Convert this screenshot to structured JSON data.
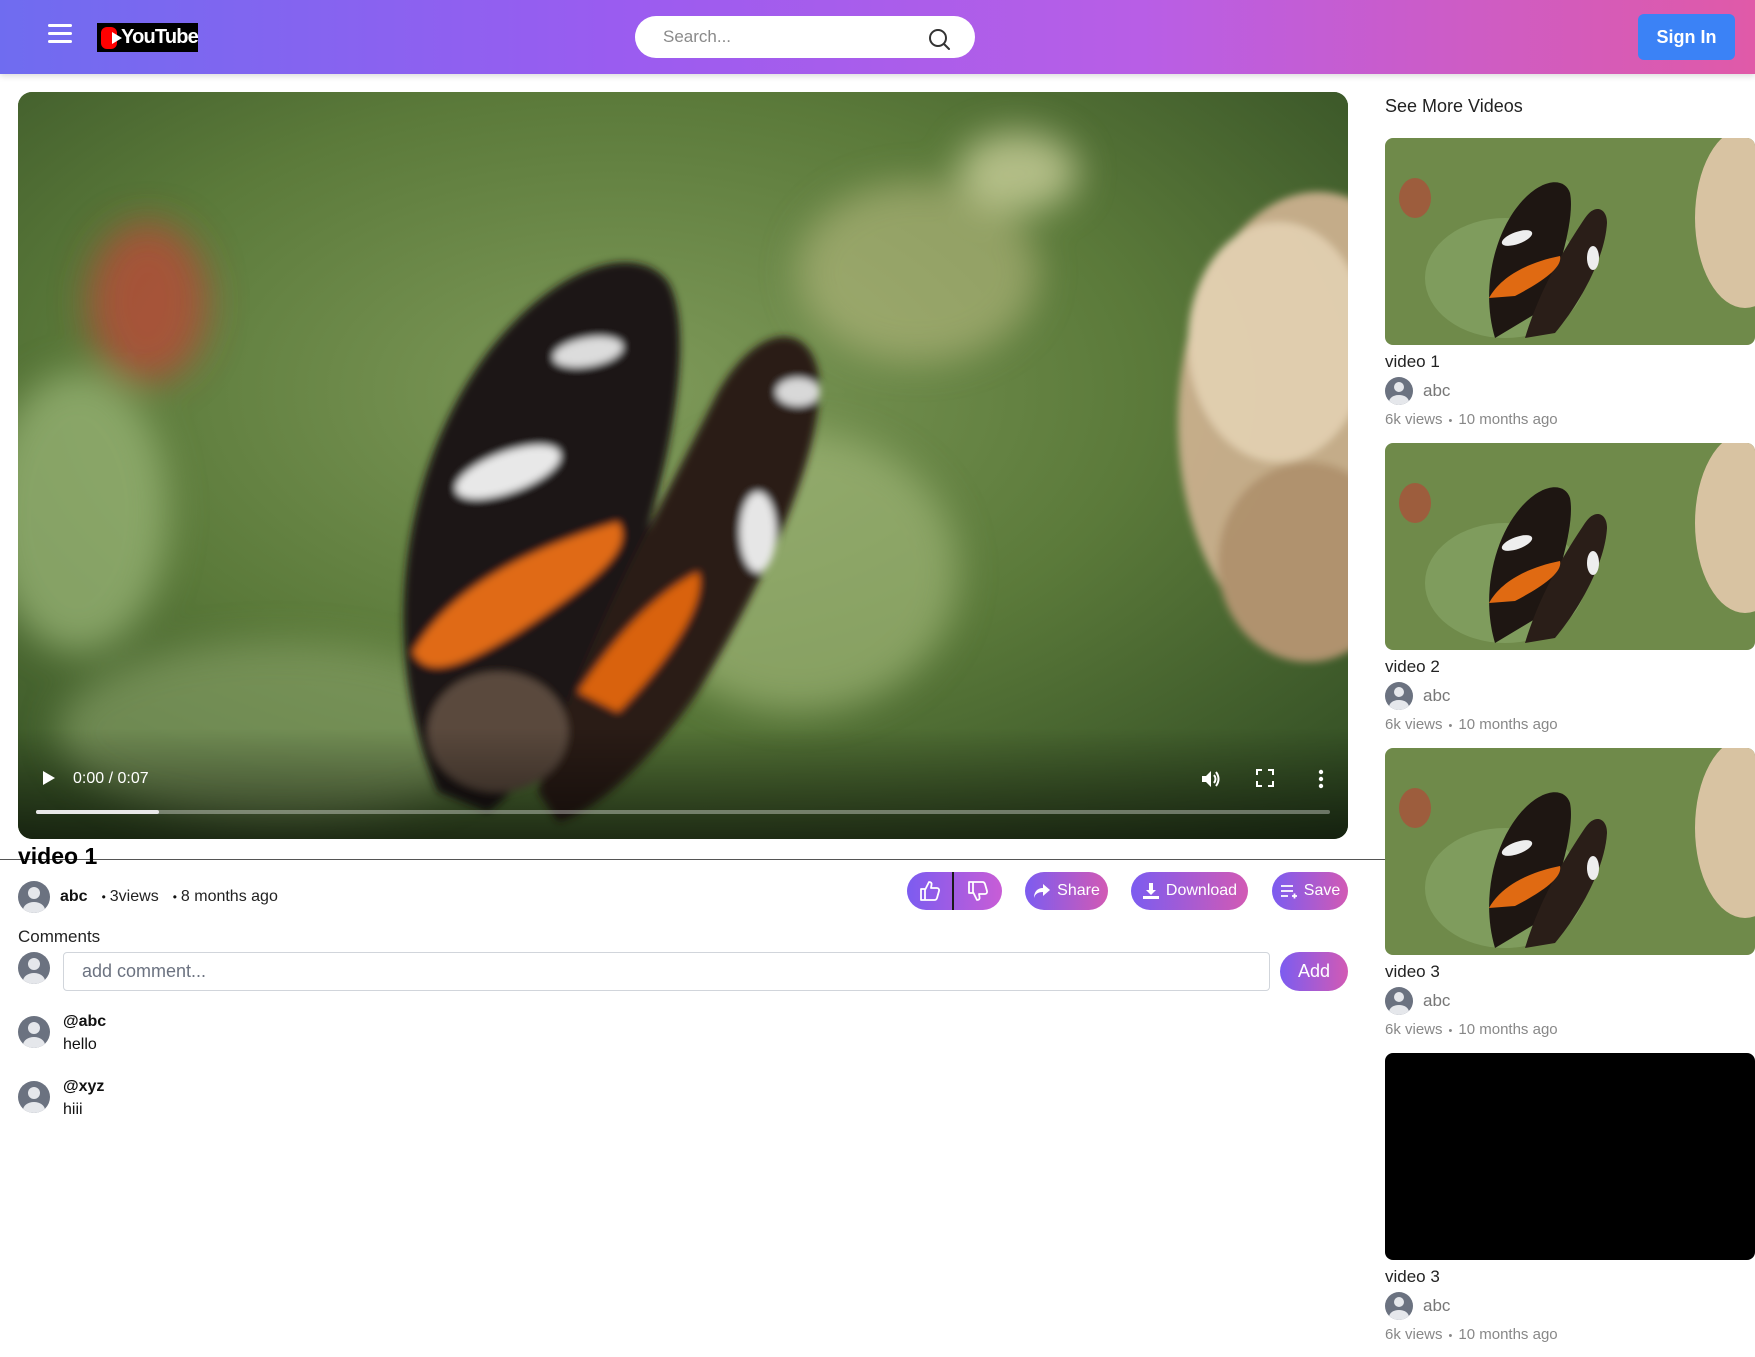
{
  "header": {
    "logo_text": "YouTube",
    "search_placeholder": "Search...",
    "signin_label": "Sign In"
  },
  "player": {
    "time_display": "0:00 / 0:07",
    "progress": 0.095
  },
  "video": {
    "title": "video 1",
    "channel": "abc",
    "views": "3views",
    "uploaded": "8 months ago",
    "share_label": "Share",
    "download_label": "Download",
    "save_label": "Save"
  },
  "comments": {
    "label": "Comments",
    "input_placeholder": "add comment...",
    "add_label": "Add",
    "items": [
      {
        "author": "@abc",
        "text": "hello"
      },
      {
        "author": "@xyz",
        "text": "hiii"
      }
    ]
  },
  "sidebar": {
    "heading": "See More Videos",
    "items": [
      {
        "title": "video 1",
        "channel": "abc",
        "views": "6k views",
        "age": "10 months ago"
      },
      {
        "title": "video 2",
        "channel": "abc",
        "views": "6k views",
        "age": "10 months ago"
      },
      {
        "title": "video 3",
        "channel": "abc",
        "views": "6k views",
        "age": "10 months ago"
      },
      {
        "title": "video 3",
        "channel": "abc",
        "views": "6k views",
        "age": "10 months ago"
      }
    ]
  },
  "colors": {
    "header_gradient_start": "#6f6cf0",
    "header_gradient_end": "#e05aa8",
    "signin": "#3b82f6",
    "pill_gradient_start": "#7c5cf0",
    "pill_gradient_end": "#d25ab4"
  }
}
